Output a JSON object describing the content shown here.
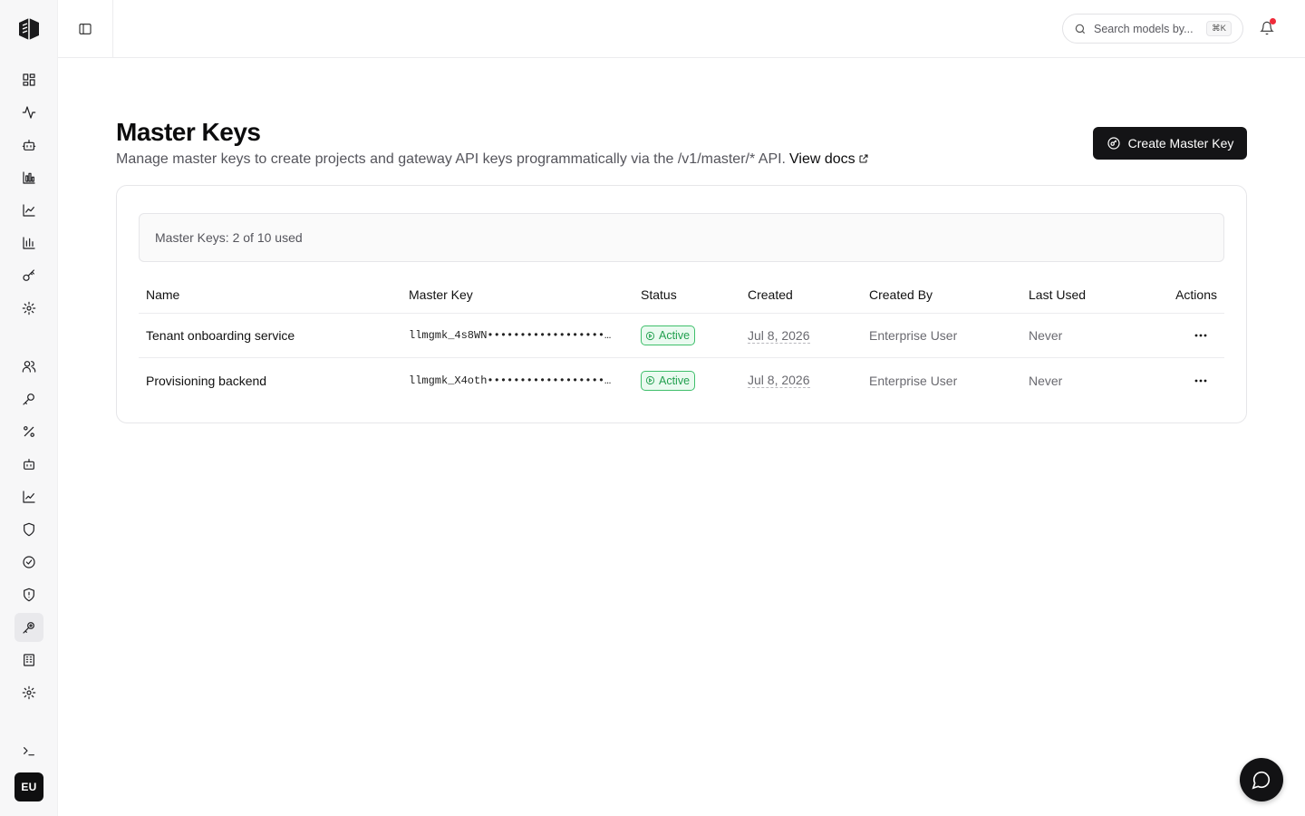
{
  "sidebar": {
    "avatar_initials": "EU",
    "icons": [
      "dashboard-icon",
      "activity-icon",
      "bot-icon",
      "bar-chart-icon",
      "line-chart-icon",
      "column-chart-icon",
      "key-icon",
      "settings-icon",
      "users-icon",
      "key-round-icon",
      "percent-icon",
      "agent-icon",
      "trend-icon",
      "shield-icon",
      "check-circle-icon",
      "shield-alert-icon",
      "master-key-icon",
      "building-icon",
      "gear-icon",
      "terminal-icon"
    ],
    "active_icon": "master-key-icon"
  },
  "topbar": {
    "search_placeholder": "Search models by...",
    "search_shortcut": "⌘K"
  },
  "header": {
    "title": "Master Keys",
    "subtitle": "Manage master keys to create projects and gateway API keys programmatically via the /v1/master/* API.",
    "docs_link": "View docs",
    "create_button": "Create Master Key"
  },
  "usage": {
    "text": "Master Keys: 2 of 10 used"
  },
  "table": {
    "columns": {
      "name": "Name",
      "key": "Master Key",
      "status": "Status",
      "created": "Created",
      "created_by": "Created By",
      "last_used": "Last Used",
      "actions": "Actions"
    },
    "rows": [
      {
        "name": "Tenant onboarding service",
        "key": "llmgmk_4s8WN••••••••••••••••••…",
        "status": "Active",
        "created": "Jul 8, 2026",
        "created_by": "Enterprise User",
        "last_used": "Never"
      },
      {
        "name": "Provisioning backend",
        "key": "llmgmk_X4oth••••••••••••••••••…",
        "status": "Active",
        "created": "Jul 8, 2026",
        "created_by": "Enterprise User",
        "last_used": "Never"
      }
    ]
  },
  "colors": {
    "accent": "#141416",
    "status_active": "#22a04f",
    "notification": "#ef2b3a"
  }
}
